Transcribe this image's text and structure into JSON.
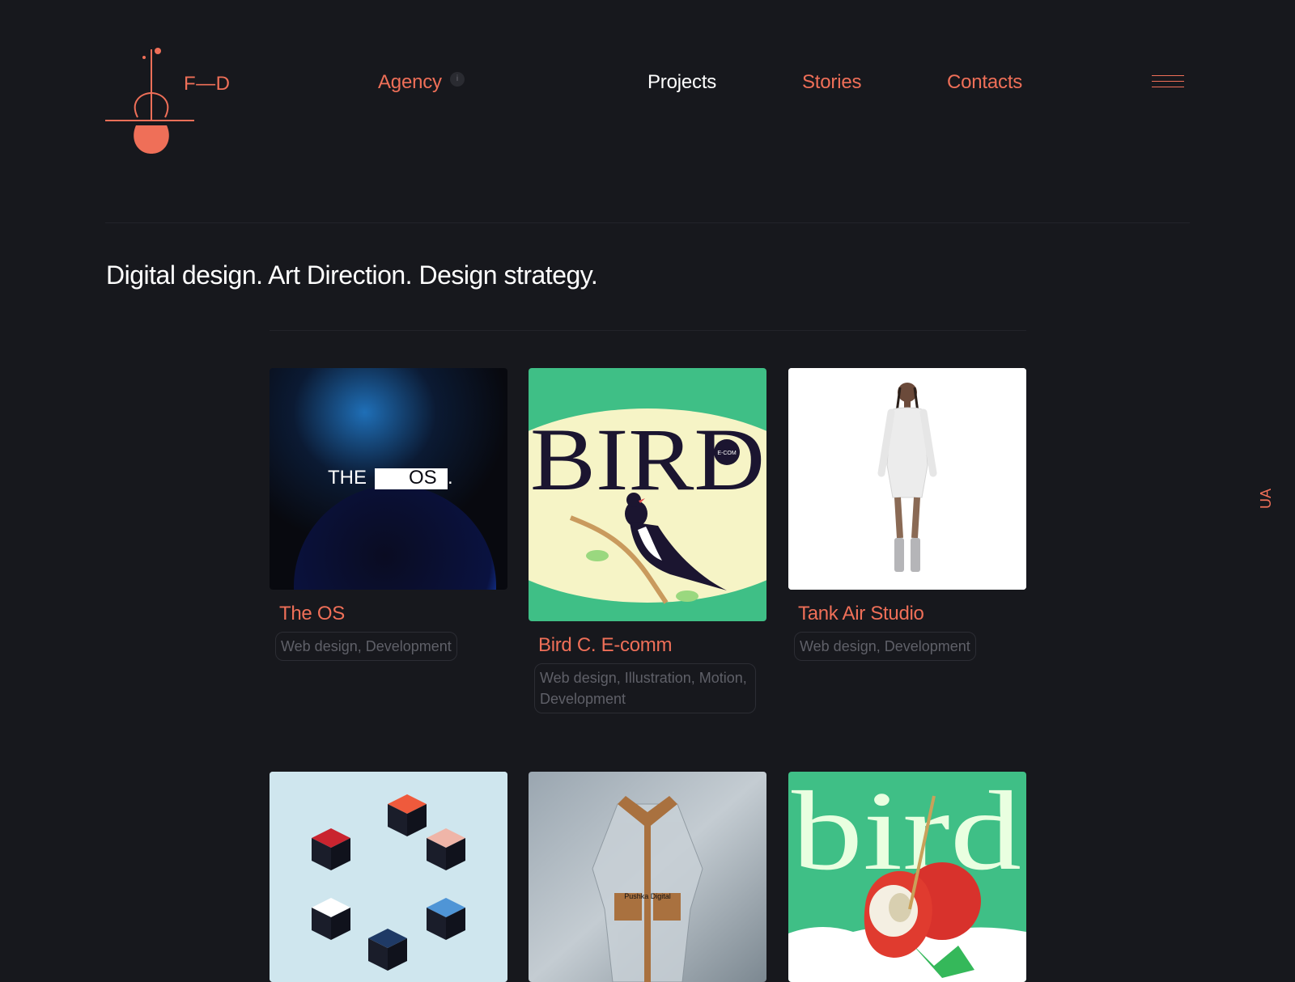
{
  "header": {
    "logo_text": "F—D",
    "nav": [
      {
        "label": "Agency",
        "badge": "i"
      },
      {
        "label": "Projects"
      },
      {
        "label": "Stories"
      },
      {
        "label": "Contacts"
      }
    ],
    "menu_icon": "hamburger-icon"
  },
  "tagline": "Digital design. Art Direction. Design strategy.",
  "language": "UA",
  "projects": [
    {
      "title": "The OS",
      "tags": "Web design, Development",
      "thumb_text": [
        "THE",
        "OS",
        "."
      ]
    },
    {
      "title": "Bird C. E-comm",
      "tags": "Web design, Illustration, Motion, Development",
      "thumb_text": [
        "BIRD",
        "E-COM"
      ]
    },
    {
      "title": "Tank Air Studio",
      "tags": "Web design, Development"
    },
    {
      "title": "",
      "tags": ""
    },
    {
      "title": "",
      "tags": "",
      "thumb_text": [
        "Pushka Digital"
      ]
    },
    {
      "title": "",
      "tags": "",
      "thumb_text": [
        "bird"
      ]
    }
  ],
  "colors": {
    "background": "#17181d",
    "accent": "#ef6f58",
    "text": "#ffffff",
    "muted": "#5f6068",
    "bird_green": "#3fbf86",
    "bird_cream": "#f6f4c6"
  }
}
